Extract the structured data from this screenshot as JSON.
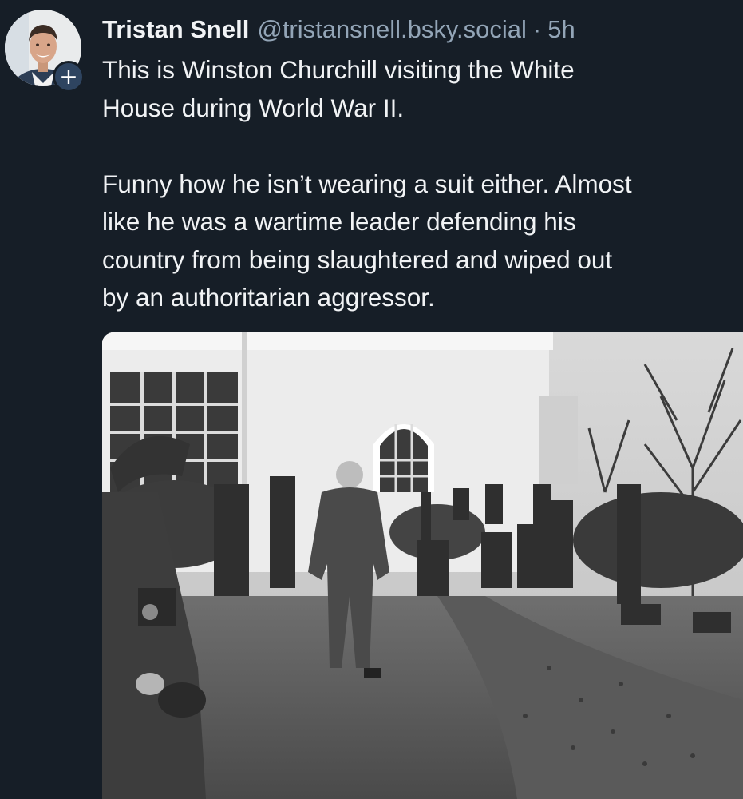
{
  "author": {
    "display_name": "Tristan Snell",
    "handle": "@tristansnell.bsky.social",
    "separator": "·",
    "timestamp": "5h",
    "avatar_icon": "profile-photo",
    "follow_icon": "plus-icon",
    "follow_symbol": "+"
  },
  "post": {
    "text": "This is Winston Churchill visiting the White\nHouse during World War II.\n\nFunny how he isn’t wearing a suit either. Almost\nlike he was a wartime leader defending his\ncountry from being slaughtered and wiped out\nby an authoritarian aggressor."
  },
  "colors": {
    "background": "#161e27",
    "text_primary": "#f1f3f5",
    "text_secondary": "#93a5b7",
    "follow_badge": "#2e4460"
  }
}
